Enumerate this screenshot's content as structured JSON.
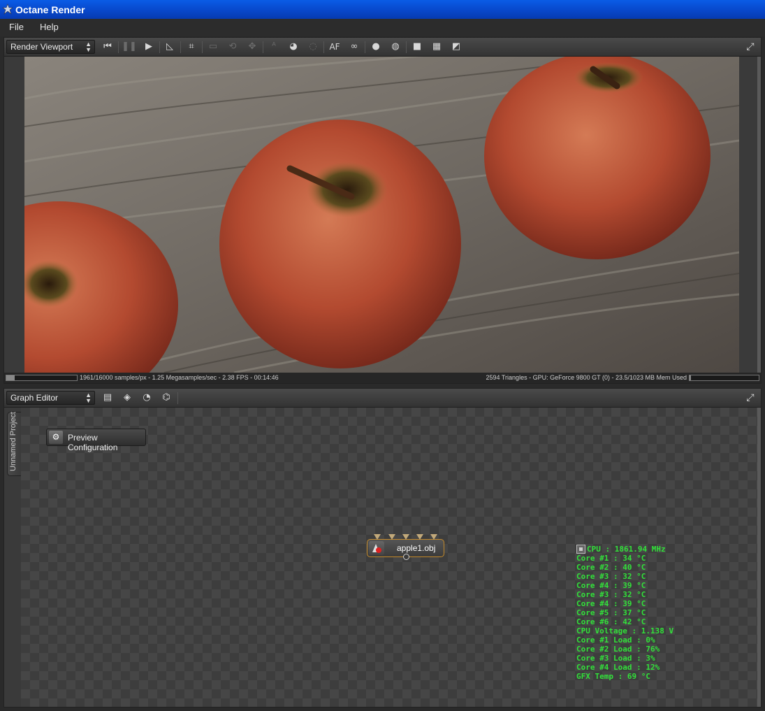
{
  "window": {
    "title": "Octane Render",
    "icon": "octane-logo-icon"
  },
  "menu": [
    "File",
    "Help"
  ],
  "render_panel": {
    "selector": "Render Viewport",
    "toolbar_icons": [
      "skip-back-icon",
      "pause-icon",
      "play-icon",
      "ruler-icon",
      "focus-pick-icon",
      "region-icon",
      "rotate-icon",
      "transform-icon",
      "autofocus-pick-icon",
      "material-pick-icon",
      "object-pick-icon",
      "af-text",
      "glasses-icon",
      "sphere-icon",
      "sphere-alt-icon",
      "square-icon",
      "checker-icon",
      "half-square-icon"
    ],
    "af_label": "AF",
    "status_left": "1961/16000 samples/px - 1.25 Megasamples/sec - 2.38 FPS - 00:14:46",
    "status_right": "2594 Triangles - GPU: GeForce 9800 GT (0) - 23.5/1023 MB Mem Used",
    "progress": 0.12
  },
  "graph_panel": {
    "selector": "Graph Editor",
    "toolbar_icons": [
      "save-icon",
      "material-icon",
      "sphere-refresh-icon",
      "mesh-icon"
    ],
    "side_tab": "Unnamed Project",
    "preview_button": "Preview Configuration",
    "node": {
      "label": "apple1.obj",
      "inputs": 5
    },
    "stats": [
      "CPU : 1861.94 MHz",
      "Core #1 : 34 °C",
      "Core #2 : 40 °C",
      "Core #3 : 32 °C",
      "Core #4 : 39 °C",
      "Core #3 : 32 °C",
      "Core #4 : 39 °C",
      "Core #5 : 37 °C",
      "Core #6 : 42 °C",
      "CPU Voltage : 1.138 V",
      "Core #1 Load : 0%",
      "Core #2 Load : 76%",
      "Core #3 Load : 3%",
      "Core #4 Load : 12%",
      "GFX Temp : 69 °C"
    ]
  }
}
